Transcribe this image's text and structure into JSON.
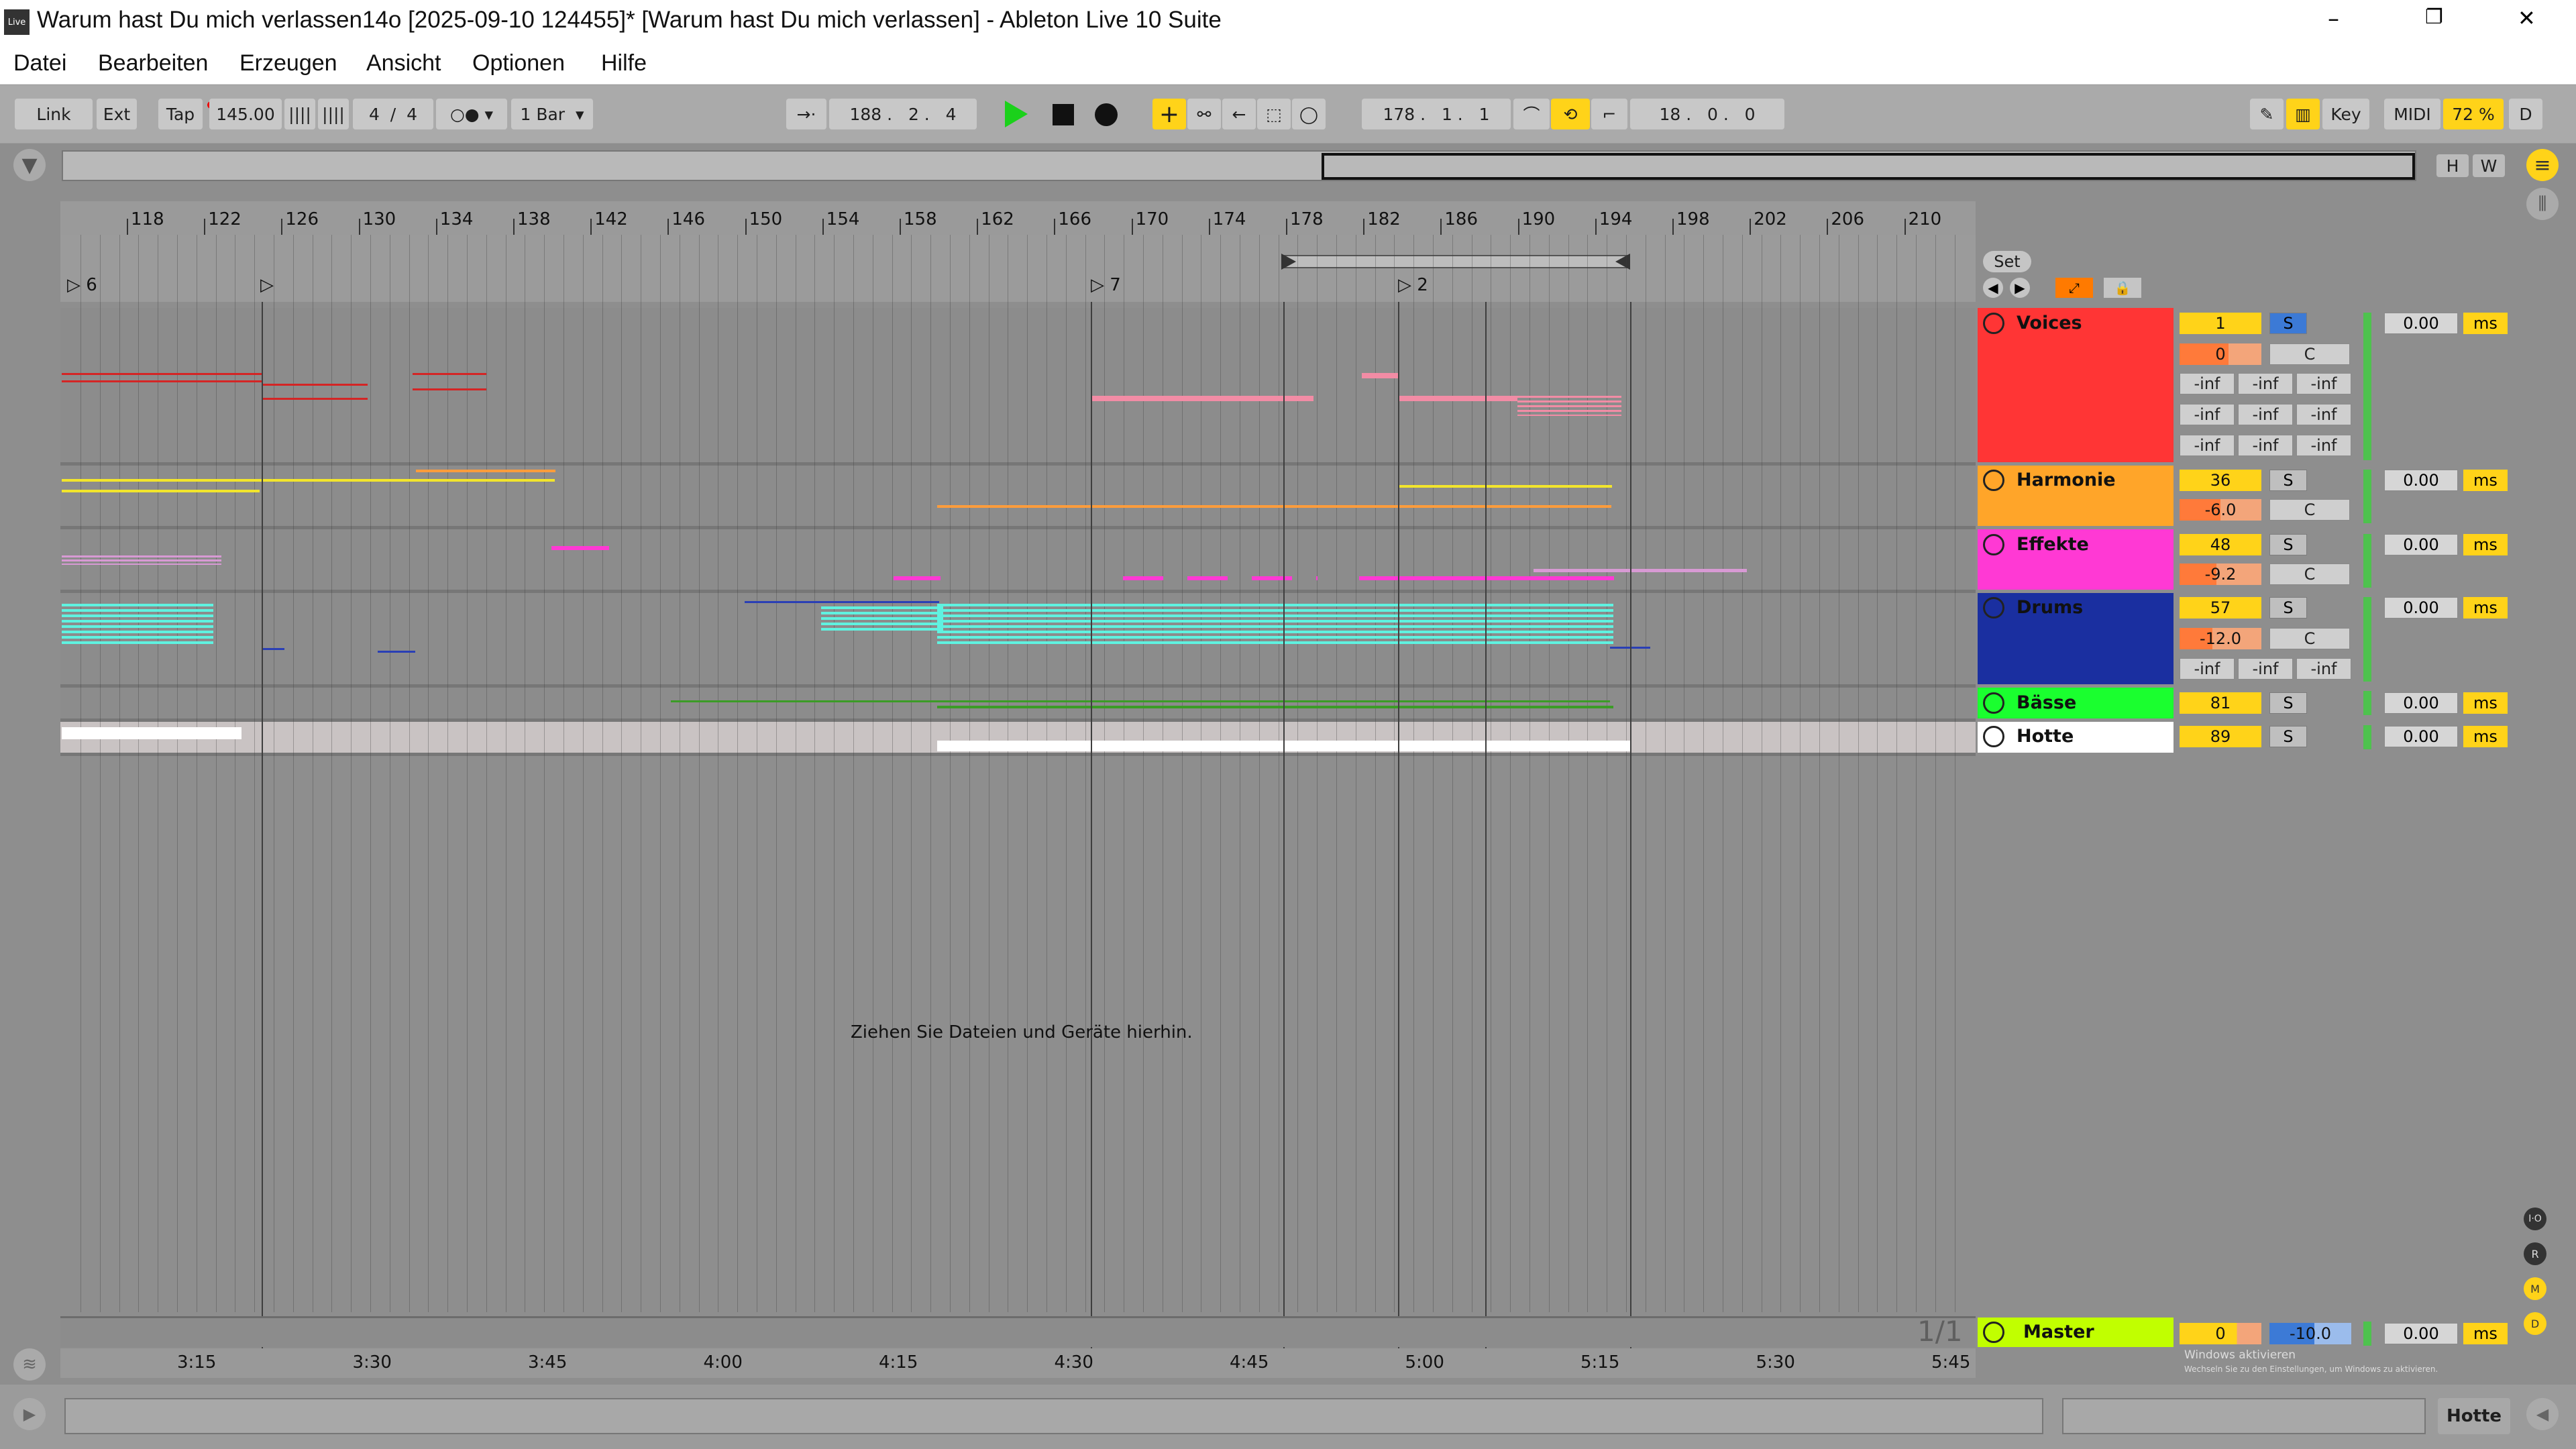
{
  "window": {
    "title": "Warum hast Du mich verlassen14o [2025-09-10 124455]*  [Warum hast Du mich verlassen] - Ableton Live 10 Suite",
    "app_icon": "Live",
    "controls": {
      "minimize": "–",
      "restore": "❐",
      "close": "✕"
    }
  },
  "menu": [
    "Datei",
    "Bearbeiten",
    "Erzeugen",
    "Ansicht",
    "Optionen",
    "Hilfe"
  ],
  "control_bar": {
    "link": "Link",
    "ext": "Ext",
    "tap": "Tap",
    "tempo": "145.00",
    "signature": "4  /  4",
    "quantization": "1 Bar",
    "follow_position": "188 .   2 .   4",
    "loop_start": "178 .   1 .   1",
    "loop_length": "18 .   0 .   0",
    "key": "Key",
    "midi": "MIDI",
    "cpu": "72 %",
    "d": "D"
  },
  "overview": {
    "h": "H",
    "w": "W"
  },
  "ruler_bars": [
    "118",
    "122",
    "126",
    "130",
    "134",
    "138",
    "142",
    "146",
    "150",
    "154",
    "158",
    "162",
    "166",
    "170",
    "174",
    "178",
    "182",
    "186",
    "190",
    "194",
    "198",
    "202",
    "206",
    "210"
  ],
  "locators": [
    "6",
    "7",
    "2"
  ],
  "set_button": "Set",
  "drop_hint": "Ziehen Sie Dateien und Geräte hierhin.",
  "track_colors": {
    "Voices": "#ff3535",
    "Harmonie": "#ffa529",
    "Effekte": "#ff39d4",
    "Drums": "#1a2fa0",
    "Bässe": "#1aff2f",
    "Hotte": "#ffffff",
    "Master": "#c1ff00"
  },
  "tracks": [
    {
      "name": "Voices",
      "number": "1",
      "solo": "S",
      "pan_value": "0",
      "pan_c": "C",
      "sends": [
        "-inf",
        "-inf",
        "-inf",
        "-inf",
        "-inf",
        "-inf",
        "-inf",
        "-inf",
        "-inf"
      ],
      "delay": "0.00",
      "unit": "ms"
    },
    {
      "name": "Harmonie",
      "number": "36",
      "solo": "S",
      "pan_value": "-6.0",
      "pan_c": "C",
      "delay": "0.00",
      "unit": "ms"
    },
    {
      "name": "Effekte",
      "number": "48",
      "solo": "S",
      "pan_value": "-9.2",
      "pan_c": "C",
      "delay": "0.00",
      "unit": "ms"
    },
    {
      "name": "Drums",
      "number": "57",
      "solo": "S",
      "pan_value": "-12.0",
      "pan_c": "C",
      "sends": [
        "-inf",
        "-inf",
        "-inf"
      ],
      "delay": "0.00",
      "unit": "ms"
    },
    {
      "name": "Bässe",
      "number": "81",
      "solo": "S",
      "delay": "0.00",
      "unit": "ms"
    },
    {
      "name": "Hotte",
      "number": "89",
      "solo": "S",
      "delay": "0.00",
      "unit": "ms"
    }
  ],
  "master": {
    "name": "Master",
    "value": "0",
    "volume": "-10.0",
    "delay": "0.00",
    "unit": "ms"
  },
  "page_indicator": "1/1",
  "time_ruler": [
    "3:15",
    "3:30",
    "3:45",
    "4:00",
    "4:15",
    "4:30",
    "4:45",
    "5:00",
    "5:15",
    "5:30",
    "5:45"
  ],
  "side_icons": [
    "I·O",
    "R",
    "M",
    "D"
  ],
  "watermark": {
    "title": "Windows aktivieren",
    "text": "Wechseln Sie zu den Einstellungen, um Windows zu aktivieren."
  },
  "status_bar": {
    "selected_track": "Hotte"
  }
}
